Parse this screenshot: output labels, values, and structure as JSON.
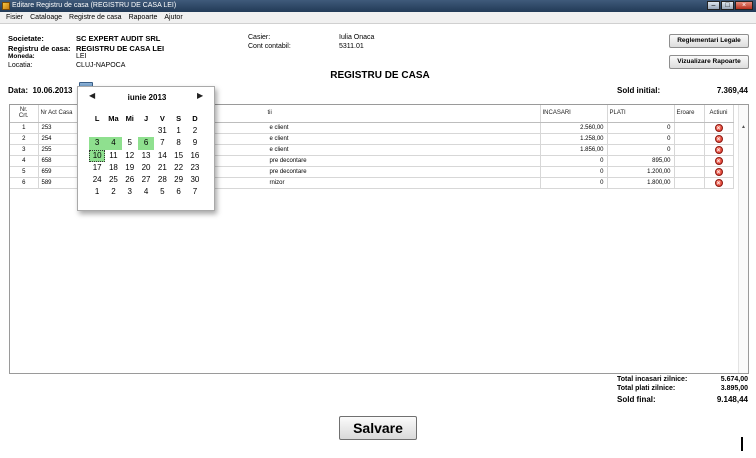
{
  "window": {
    "title": "Editare Registru de casa (REGISTRU DE CASA LEI)"
  },
  "menu": [
    "Fisier",
    "Cataloage",
    "Registre de casa",
    "Rapoarte",
    "Ajutor"
  ],
  "info": {
    "societate_label": "Societate:",
    "societate": "SC EXPERT AUDIT SRL",
    "registru_label": "Registru de casa:",
    "registru": "REGISTRU DE CASA LEI",
    "moneda_label": "Moneda:",
    "moneda": "LEI",
    "locatia_label": "Locatia:",
    "locatia": "CLUJ-NAPOCA",
    "casier_label": "Casier:",
    "casier": "Iulia Onaca",
    "cont_label": "Cont contabil:",
    "cont": "5311.01"
  },
  "buttons": {
    "reglementari": "Reglementari Legale",
    "rapoarte": "Vizualizare Rapoarte",
    "salvare": "Salvare"
  },
  "heading": "REGISTRU DE CASA",
  "date": {
    "label": "Data:",
    "value": "10.06.2013"
  },
  "sold_initial": {
    "label": "Sold initial:",
    "value": "7.369,44"
  },
  "table": {
    "headers": {
      "nr": "Nr.\nCrt.",
      "act": "Nr Act Casa",
      "explicatii": "tii",
      "incasari": "INCASARI",
      "plati": "PLATI",
      "eroare": "Eroare",
      "actiuni": "Actiuni"
    },
    "rows": [
      {
        "nr": "1",
        "act": "253",
        "expl": "e client",
        "inc": "2.560,00",
        "plati": "0"
      },
      {
        "nr": "2",
        "act": "254",
        "expl": "e client",
        "inc": "1.258,00",
        "plati": "0"
      },
      {
        "nr": "3",
        "act": "255",
        "expl": "e client",
        "inc": "1.856,00",
        "plati": "0"
      },
      {
        "nr": "4",
        "act": "658",
        "expl": "pre decontare",
        "inc": "0",
        "plati": "895,00"
      },
      {
        "nr": "5",
        "act": "659",
        "expl": "pre decontare",
        "inc": "0",
        "plati": "1.200,00"
      },
      {
        "nr": "6",
        "act": "589",
        "expl": "rnizor",
        "inc": "0",
        "plati": "1.800,00"
      }
    ]
  },
  "calendar": {
    "month": "iunie 2013",
    "weekdays": [
      "L",
      "Ma",
      "Mi",
      "J",
      "V",
      "S",
      "D"
    ],
    "weeks": [
      [
        "",
        "",
        "",
        "",
        "31",
        "1",
        "2"
      ],
      [
        "3",
        "4",
        "5",
        "6",
        "7",
        "8",
        "9"
      ],
      [
        "10",
        "11",
        "12",
        "13",
        "14",
        "15",
        "16"
      ],
      [
        "17",
        "18",
        "19",
        "20",
        "21",
        "22",
        "23"
      ],
      [
        "24",
        "25",
        "26",
        "27",
        "28",
        "29",
        "30"
      ],
      [
        "1",
        "2",
        "3",
        "4",
        "5",
        "6",
        "7"
      ]
    ],
    "highlighted": [
      "3",
      "4",
      "6"
    ],
    "selected": "10",
    "highlight_color": "#8fe08f"
  },
  "totals": {
    "incasari_label": "Total incasari zilnice:",
    "incasari": "5.674,00",
    "plati_label": "Total plati zilnice:",
    "plati": "3.895,00",
    "sold_label": "Sold final:",
    "sold": "9.148,44"
  },
  "icons": {
    "delete": "delete-icon",
    "calendar_prev": "chevron-left-icon",
    "calendar_next": "chevron-right-icon"
  }
}
